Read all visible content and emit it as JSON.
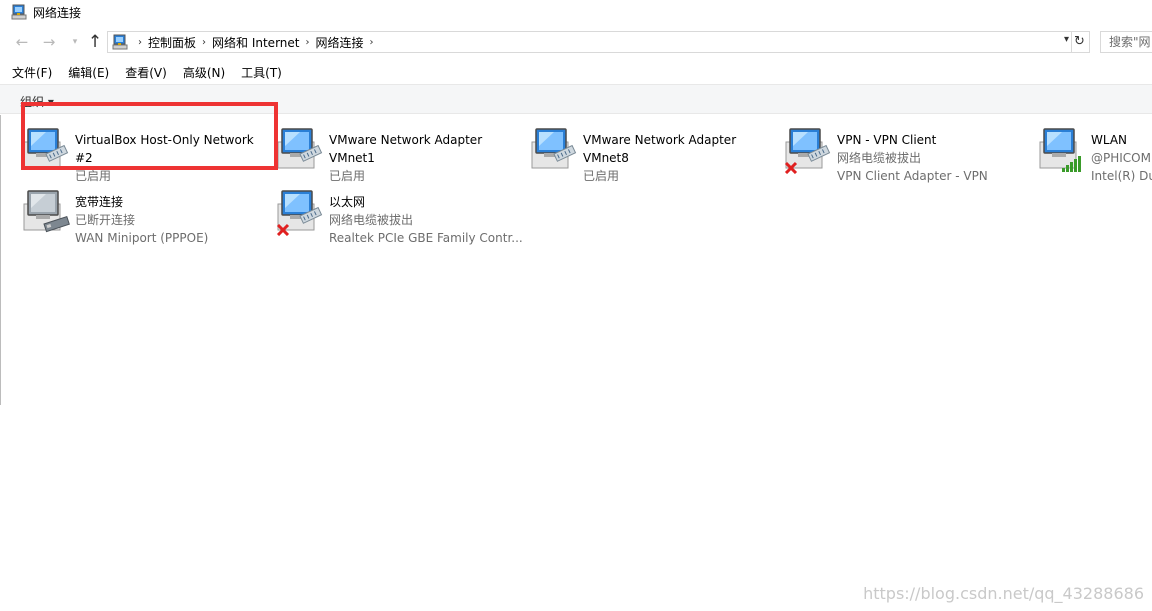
{
  "window": {
    "title": "网络连接"
  },
  "address": {
    "crumbs": [
      "控制面板",
      "网络和 Internet",
      "网络连接"
    ],
    "search_placeholder": "搜索\"网"
  },
  "menu": [
    "文件(F)",
    "编辑(E)",
    "查看(V)",
    "高级(N)",
    "工具(T)"
  ],
  "command_bar": {
    "organize": "组织 ▾"
  },
  "connections": [
    {
      "name": "VirtualBox Host-Only Network",
      "name2": "#2",
      "status": "已启用",
      "device": "",
      "state": "enabled",
      "kind": "ethernet"
    },
    {
      "name": "VMware Network Adapter",
      "name2": "VMnet1",
      "status": "已启用",
      "device": "",
      "state": "enabled",
      "kind": "ethernet"
    },
    {
      "name": "VMware Network Adapter",
      "name2": "VMnet8",
      "status": "已启用",
      "device": "",
      "state": "enabled",
      "kind": "ethernet"
    },
    {
      "name": "VPN - VPN Client",
      "name2": "",
      "status": "网络电缆被拔出",
      "device": "VPN Client Adapter - VPN",
      "state": "disconnected",
      "kind": "ethernet"
    },
    {
      "name": "WLAN",
      "name2": "",
      "status": "@PHICOM",
      "device": "Intel(R) Dua",
      "state": "wifi",
      "kind": "wifi"
    },
    {
      "name": "宽带连接",
      "name2": "",
      "status": "已断开连接",
      "device": "WAN Miniport (PPPOE)",
      "state": "broadband",
      "kind": "broadband"
    },
    {
      "name": "以太网",
      "name2": "",
      "status": "网络电缆被拔出",
      "device": "Realtek PCIe GBE Family Contr...",
      "state": "disconnected",
      "kind": "ethernet"
    }
  ],
  "watermark": "https://blog.csdn.net/qq_43288686",
  "colors": {
    "highlight": "#ee3333",
    "screen_blue": "#2a7fd6",
    "error_red": "#e02020",
    "wifi_green": "#3a9b2a"
  }
}
